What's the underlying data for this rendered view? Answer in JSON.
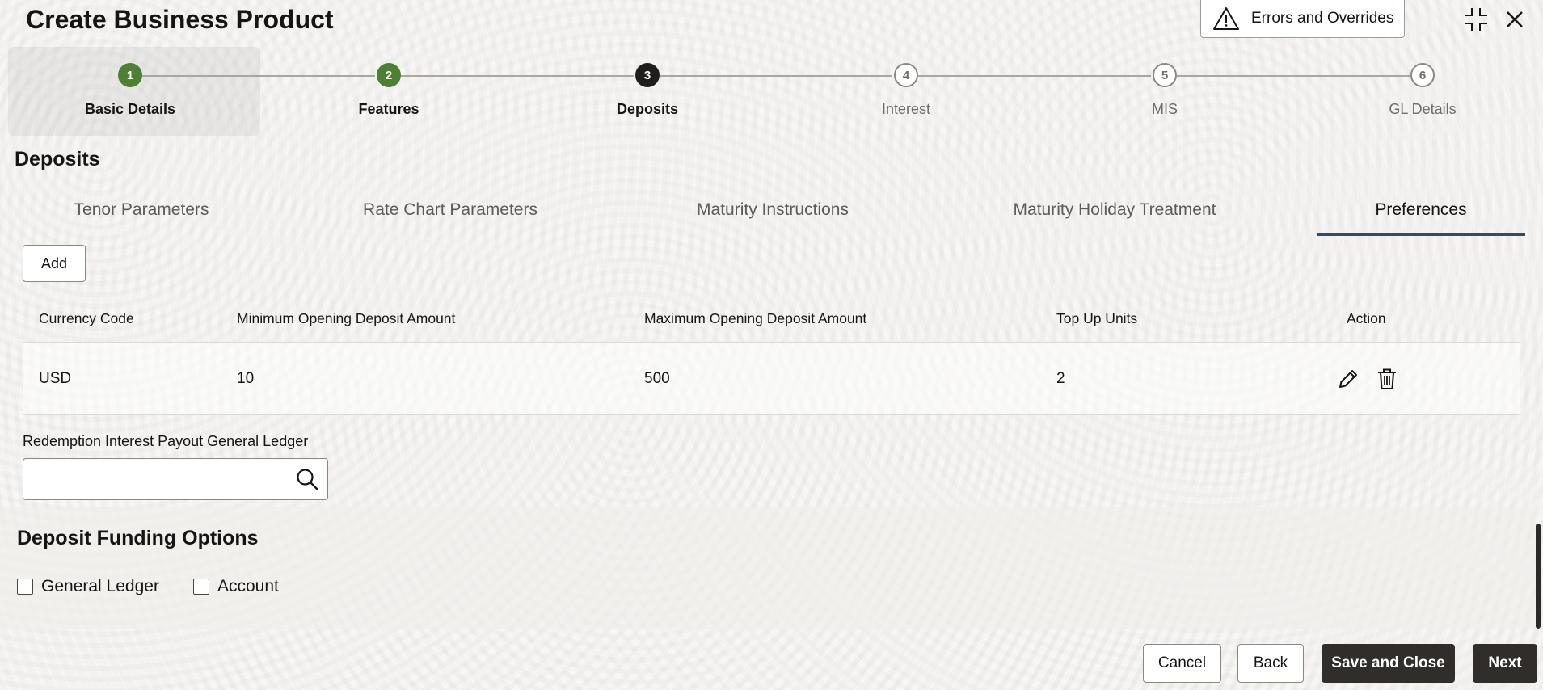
{
  "header": {
    "title": "Create Business Product",
    "errors_button_label": "Errors and Overrides"
  },
  "stepper": {
    "steps": [
      {
        "number": "1",
        "label": "Basic Details",
        "state": "done"
      },
      {
        "number": "2",
        "label": "Features",
        "state": "done"
      },
      {
        "number": "3",
        "label": "Deposits",
        "state": "current"
      },
      {
        "number": "4",
        "label": "Interest",
        "state": "todo"
      },
      {
        "number": "5",
        "label": "MIS",
        "state": "todo"
      },
      {
        "number": "6",
        "label": "GL Details",
        "state": "todo"
      }
    ]
  },
  "section": {
    "title": "Deposits",
    "tabs": [
      {
        "label": "Tenor Parameters",
        "active": false
      },
      {
        "label": "Rate Chart Parameters",
        "active": false
      },
      {
        "label": "Maturity Instructions",
        "active": false
      },
      {
        "label": "Maturity Holiday Treatment",
        "active": false
      },
      {
        "label": "Preferences",
        "active": true
      }
    ]
  },
  "preferences": {
    "add_button_label": "Add",
    "columns": [
      "Currency Code",
      "Minimum Opening Deposit Amount",
      "Maximum Opening Deposit Amount",
      "Top Up Units",
      "Action"
    ],
    "rows": [
      {
        "currency": "USD",
        "min_amount": "10",
        "max_amount": "500",
        "top_up_units": "2"
      }
    ],
    "gl_field": {
      "label": "Redemption Interest Payout General Ledger",
      "value": "",
      "placeholder": ""
    }
  },
  "funding": {
    "title": "Deposit Funding Options",
    "options": [
      {
        "label": "General Ledger",
        "checked": false
      },
      {
        "label": "Account",
        "checked": false
      }
    ]
  },
  "footer": {
    "cancel_label": "Cancel",
    "back_label": "Back",
    "save_close_label": "Save and Close",
    "next_label": "Next"
  },
  "colors": {
    "step_done": "#4d7f34",
    "step_current": "#1f1e1c",
    "tab_active_underline": "#3a4a5c",
    "primary_button": "#312d2a"
  }
}
